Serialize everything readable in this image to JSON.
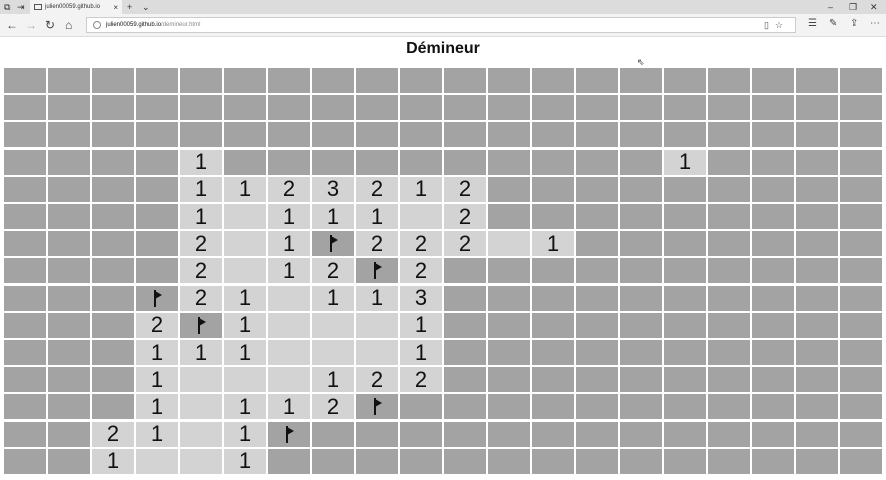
{
  "browser": {
    "tab_title": "julien00059.github.io",
    "url_host": "julien00059.github.io",
    "url_path": "/demineur.html",
    "new_tab": "+",
    "tab_menu": "⌄",
    "close": "×",
    "minimize": "–",
    "restore": "❐",
    "window_close": "✕"
  },
  "page": {
    "title": "Démineur"
  },
  "board": {
    "columns": 20,
    "rows": 15,
    "cells": [
      [
        "",
        "",
        "",
        "",
        "",
        "",
        "",
        "",
        "",
        "",
        "",
        "",
        "",
        "",
        "",
        "",
        "",
        "",
        "",
        ""
      ],
      [
        "",
        "",
        "",
        "",
        "",
        "",
        "",
        "",
        "",
        "",
        "",
        "",
        "",
        "",
        "",
        "",
        "",
        "",
        "",
        ""
      ],
      [
        "",
        "",
        "",
        "",
        "",
        "",
        "",
        "",
        "",
        "",
        "",
        "",
        "",
        "",
        "",
        "",
        "",
        "",
        "",
        ""
      ],
      [
        "",
        "",
        "",
        "",
        "1",
        "",
        "",
        "",
        "",
        "",
        "",
        "",
        "",
        "",
        "",
        "1",
        "",
        "",
        "",
        ""
      ],
      [
        "",
        "",
        "",
        "",
        "1",
        "1",
        "2",
        "3",
        "2",
        "1",
        "2",
        "",
        "",
        "",
        "",
        "",
        "",
        "",
        "",
        ""
      ],
      [
        "",
        "",
        "",
        "",
        "1",
        "0",
        "1",
        "1",
        "1",
        "0",
        "2",
        "",
        "",
        "",
        "",
        "",
        "",
        "",
        "",
        ""
      ],
      [
        "",
        "",
        "",
        "",
        "2",
        "0",
        "1",
        "F",
        "2",
        "2",
        "2",
        "0",
        "1",
        "",
        "",
        "",
        "",
        "",
        "",
        ""
      ],
      [
        "",
        "",
        "",
        "",
        "2",
        "0",
        "1",
        "2",
        "F",
        "2",
        "",
        "",
        "",
        "",
        "",
        "",
        "",
        "",
        "",
        ""
      ],
      [
        "",
        "",
        "",
        "F",
        "2",
        "1",
        "0",
        "1",
        "1",
        "3",
        "",
        "",
        "",
        "",
        "",
        "",
        "",
        "",
        "",
        ""
      ],
      [
        "",
        "",
        "",
        "2",
        "F",
        "1",
        "0",
        "0",
        "0",
        "1",
        "",
        "",
        "",
        "",
        "",
        "",
        "",
        "",
        "",
        ""
      ],
      [
        "",
        "",
        "",
        "1",
        "1",
        "1",
        "0",
        "0",
        "0",
        "1",
        "",
        "",
        "",
        "",
        "",
        "",
        "",
        "",
        "",
        ""
      ],
      [
        "",
        "",
        "",
        "1",
        "0",
        "0",
        "0",
        "1",
        "2",
        "2",
        "",
        "",
        "",
        "",
        "",
        "",
        "",
        "",
        "",
        ""
      ],
      [
        "",
        "",
        "",
        "1",
        "0",
        "1",
        "1",
        "2",
        "F",
        "",
        "",
        "",
        "",
        "",
        "",
        "",
        "",
        "",
        "",
        ""
      ],
      [
        "",
        "",
        "2",
        "1",
        "0",
        "1",
        "F",
        "",
        "",
        "",
        "",
        "",
        "",
        "",
        "",
        "",
        "",
        "",
        "",
        ""
      ],
      [
        "",
        "",
        "1",
        "0",
        "0",
        "1",
        "",
        "",
        "",
        "",
        "",
        "",
        "",
        "",
        "",
        "",
        "",
        "",
        "",
        ""
      ]
    ],
    "flag_icon": "flag-icon"
  }
}
